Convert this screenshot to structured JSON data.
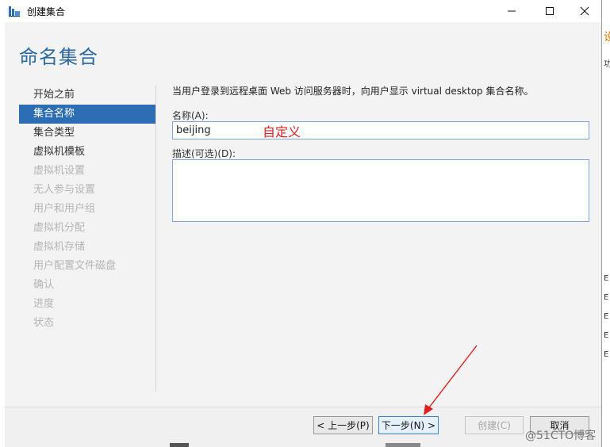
{
  "window": {
    "title": "创建集合",
    "controls": {
      "minimize": "—",
      "maximize": "☐",
      "close": "✕"
    }
  },
  "page": {
    "title": "命名集合"
  },
  "nav": {
    "items": [
      {
        "label": "开始之前",
        "state": "normal"
      },
      {
        "label": "集合名称",
        "state": "active"
      },
      {
        "label": "集合类型",
        "state": "normal"
      },
      {
        "label": "虚拟机模板",
        "state": "normal"
      },
      {
        "label": "虚拟机设置",
        "state": "disabled"
      },
      {
        "label": "无人参与设置",
        "state": "disabled"
      },
      {
        "label": "用户和用户组",
        "state": "disabled"
      },
      {
        "label": "虚拟机分配",
        "state": "disabled"
      },
      {
        "label": "虚拟机存储",
        "state": "disabled"
      },
      {
        "label": "用户配置文件磁盘",
        "state": "disabled"
      },
      {
        "label": "确认",
        "state": "disabled"
      },
      {
        "label": "进度",
        "state": "disabled"
      },
      {
        "label": "状态",
        "state": "disabled"
      }
    ]
  },
  "form": {
    "description": "当用户登录到远程桌面 Web 访问服务器时，向用户显示 virtual desktop 集合名称。",
    "name_label": "名称(A):",
    "name_value": "beijing",
    "name_annotation": "自定义",
    "desc_label": "描述(可选)(D):",
    "desc_value": ""
  },
  "buttons": {
    "prev": "< 上一步(P)",
    "next": "下一步(N) >",
    "create": "创建(C)",
    "cancel": "取消"
  },
  "side_strip": [
    "设",
    "功",
    "〈",
    "E",
    "E",
    "E",
    "E",
    "E"
  ],
  "watermark": "@51CTO博客",
  "colors": {
    "accent": "#2a6aa5",
    "nav_active": "#2c6db4",
    "annotation": "#e02020"
  }
}
